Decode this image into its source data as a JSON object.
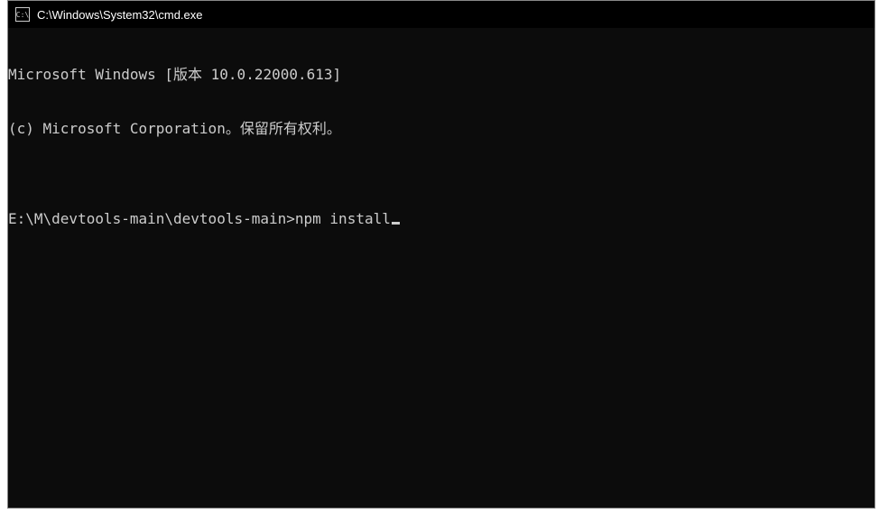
{
  "window": {
    "title": "C:\\Windows\\System32\\cmd.exe",
    "icon_label": "C:\\"
  },
  "terminal": {
    "line1": "Microsoft Windows [版本 10.0.22000.613]",
    "line2": "(c) Microsoft Corporation。保留所有权利。",
    "blank": "",
    "prompt": "E:\\M\\devtools-main\\devtools-main>",
    "command": "npm install"
  }
}
